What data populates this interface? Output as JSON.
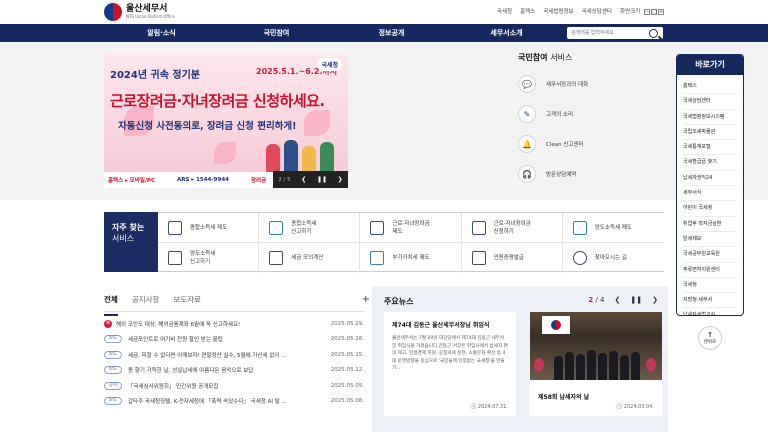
{
  "header": {
    "logo_ko": "울산세무서",
    "logo_en": "NTS Ulsan District Office",
    "util": [
      "국세청",
      "홈택스",
      "국세법령정보",
      "국세상담센터",
      "화면크기"
    ],
    "zoom": [
      "−",
      "□",
      "+"
    ]
  },
  "nav": {
    "items": [
      "알림·소식",
      "국민참여",
      "정보공개",
      "세무서소개"
    ],
    "search_placeholder": "검색어를 입력하세요"
  },
  "banner": {
    "year": "2024년 귀속 정기분",
    "period": "2025.5.1.~6.2.까지",
    "badge": "국세청",
    "headline": "근로장려금·자녀장려금 신청하세요.",
    "subline": "자동신청 사전동의로, 장려금 신청 편리하게!",
    "footer": [
      "홈택스 ▸ 모바일/PC",
      "ARS ▸ 1544-9944",
      "장려금"
    ],
    "page": "2 / 5",
    "pause": "❚❚",
    "prev": "❮",
    "next": "❯"
  },
  "participation": {
    "title_bold": "국민참여",
    "title_rest": "서비스",
    "items": [
      "세무서장과의 대화",
      "고객의 소리",
      "Clean 신고센터",
      "방문상담예약"
    ]
  },
  "quick": {
    "title": "바로가기",
    "items": [
      "홈택스",
      "국세상담센터",
      "국세법령정보시스템",
      "국립조세박물관",
      "국세통계포털",
      "국세환급금 찾기",
      "납세자권익24",
      "세무서식",
      "어린이 국세청",
      "취업후 학자금상환",
      "탈세제보",
      "국세공무원교육원",
      "주류면허지원센터",
      "국세청",
      "지방청·세무서",
      "납세자세법교실"
    ],
    "top_label": "맨위로"
  },
  "frequent": {
    "head_a": "자주 찾는",
    "head_b": "서비스",
    "items": [
      "종합소득세 제도",
      "종합소득세\n신고하기",
      "근로·자녀장려금\n제도",
      "근로·자녀장려금\n신청하기",
      "양도소득세 제도",
      "양도소득세\n신고하기",
      "세금 모의계산",
      "부가가치세 제도",
      "민원증명발급",
      "찾아오시는 길"
    ]
  },
  "notice": {
    "tabs": [
      "전체",
      "공지사항",
      "보도자료"
    ],
    "more": "+",
    "rows": [
      {
        "badge": "",
        "new": "N",
        "title": "해외 코인도 대상, 해외금융계좌 6월에 꼭 신고하세요!",
        "date": "2025.05.29."
      },
      {
        "badge": "보도",
        "new": "",
        "title": "세금포인트로 여기비 천원 할인 받는 꿀팁",
        "date": "2025.05.28."
      },
      {
        "badge": "보도",
        "new": "",
        "title": "세금, 피할 수 없다면 어깨보자! 연말정산 실수, 5월에 가산세 없이 ...",
        "date": "2025.05.15."
      },
      {
        "badge": "보도",
        "new": "",
        "title": "봄 향기 가득한 날, 성실납세에 아름다운 음악으로 보답",
        "date": "2025.05.12."
      },
      {
        "badge": "공지",
        "new": "",
        "title": "「국세심사위원회」 민간위원 공개모집",
        "date": "2025.05.09."
      },
      {
        "badge": "보도",
        "new": "",
        "title": "갑타주 국세청징텔, K-전자세청에 「폭력 속았수다」 국세청 AI 탈 ...",
        "date": "2025.05.08."
      }
    ]
  },
  "news": {
    "title": "주요뉴스",
    "current": "2",
    "sep": "/",
    "total": "4",
    "prev": "❮",
    "pause": "❚❚",
    "next": "❯",
    "card1": {
      "title": "제74대 김동근 울산세무서장님 취임식",
      "body": "울산세무서는 7월 29일 대강당에서 제74대 김동근 세무서장 취임식을 가졌습니다.김동근 서장은 취임사에서 납세자 편의 제고, 민생경제 지원, 공정과세 실현, 소통문화 확산 등 4대 운영방향을 중심으로 '국민들께 인정받는 국세청'을 만들기...",
      "date": "2024.07.31."
    },
    "card2": {
      "title": "제58회 납세자의 날",
      "date": "2024.03.04."
    }
  }
}
